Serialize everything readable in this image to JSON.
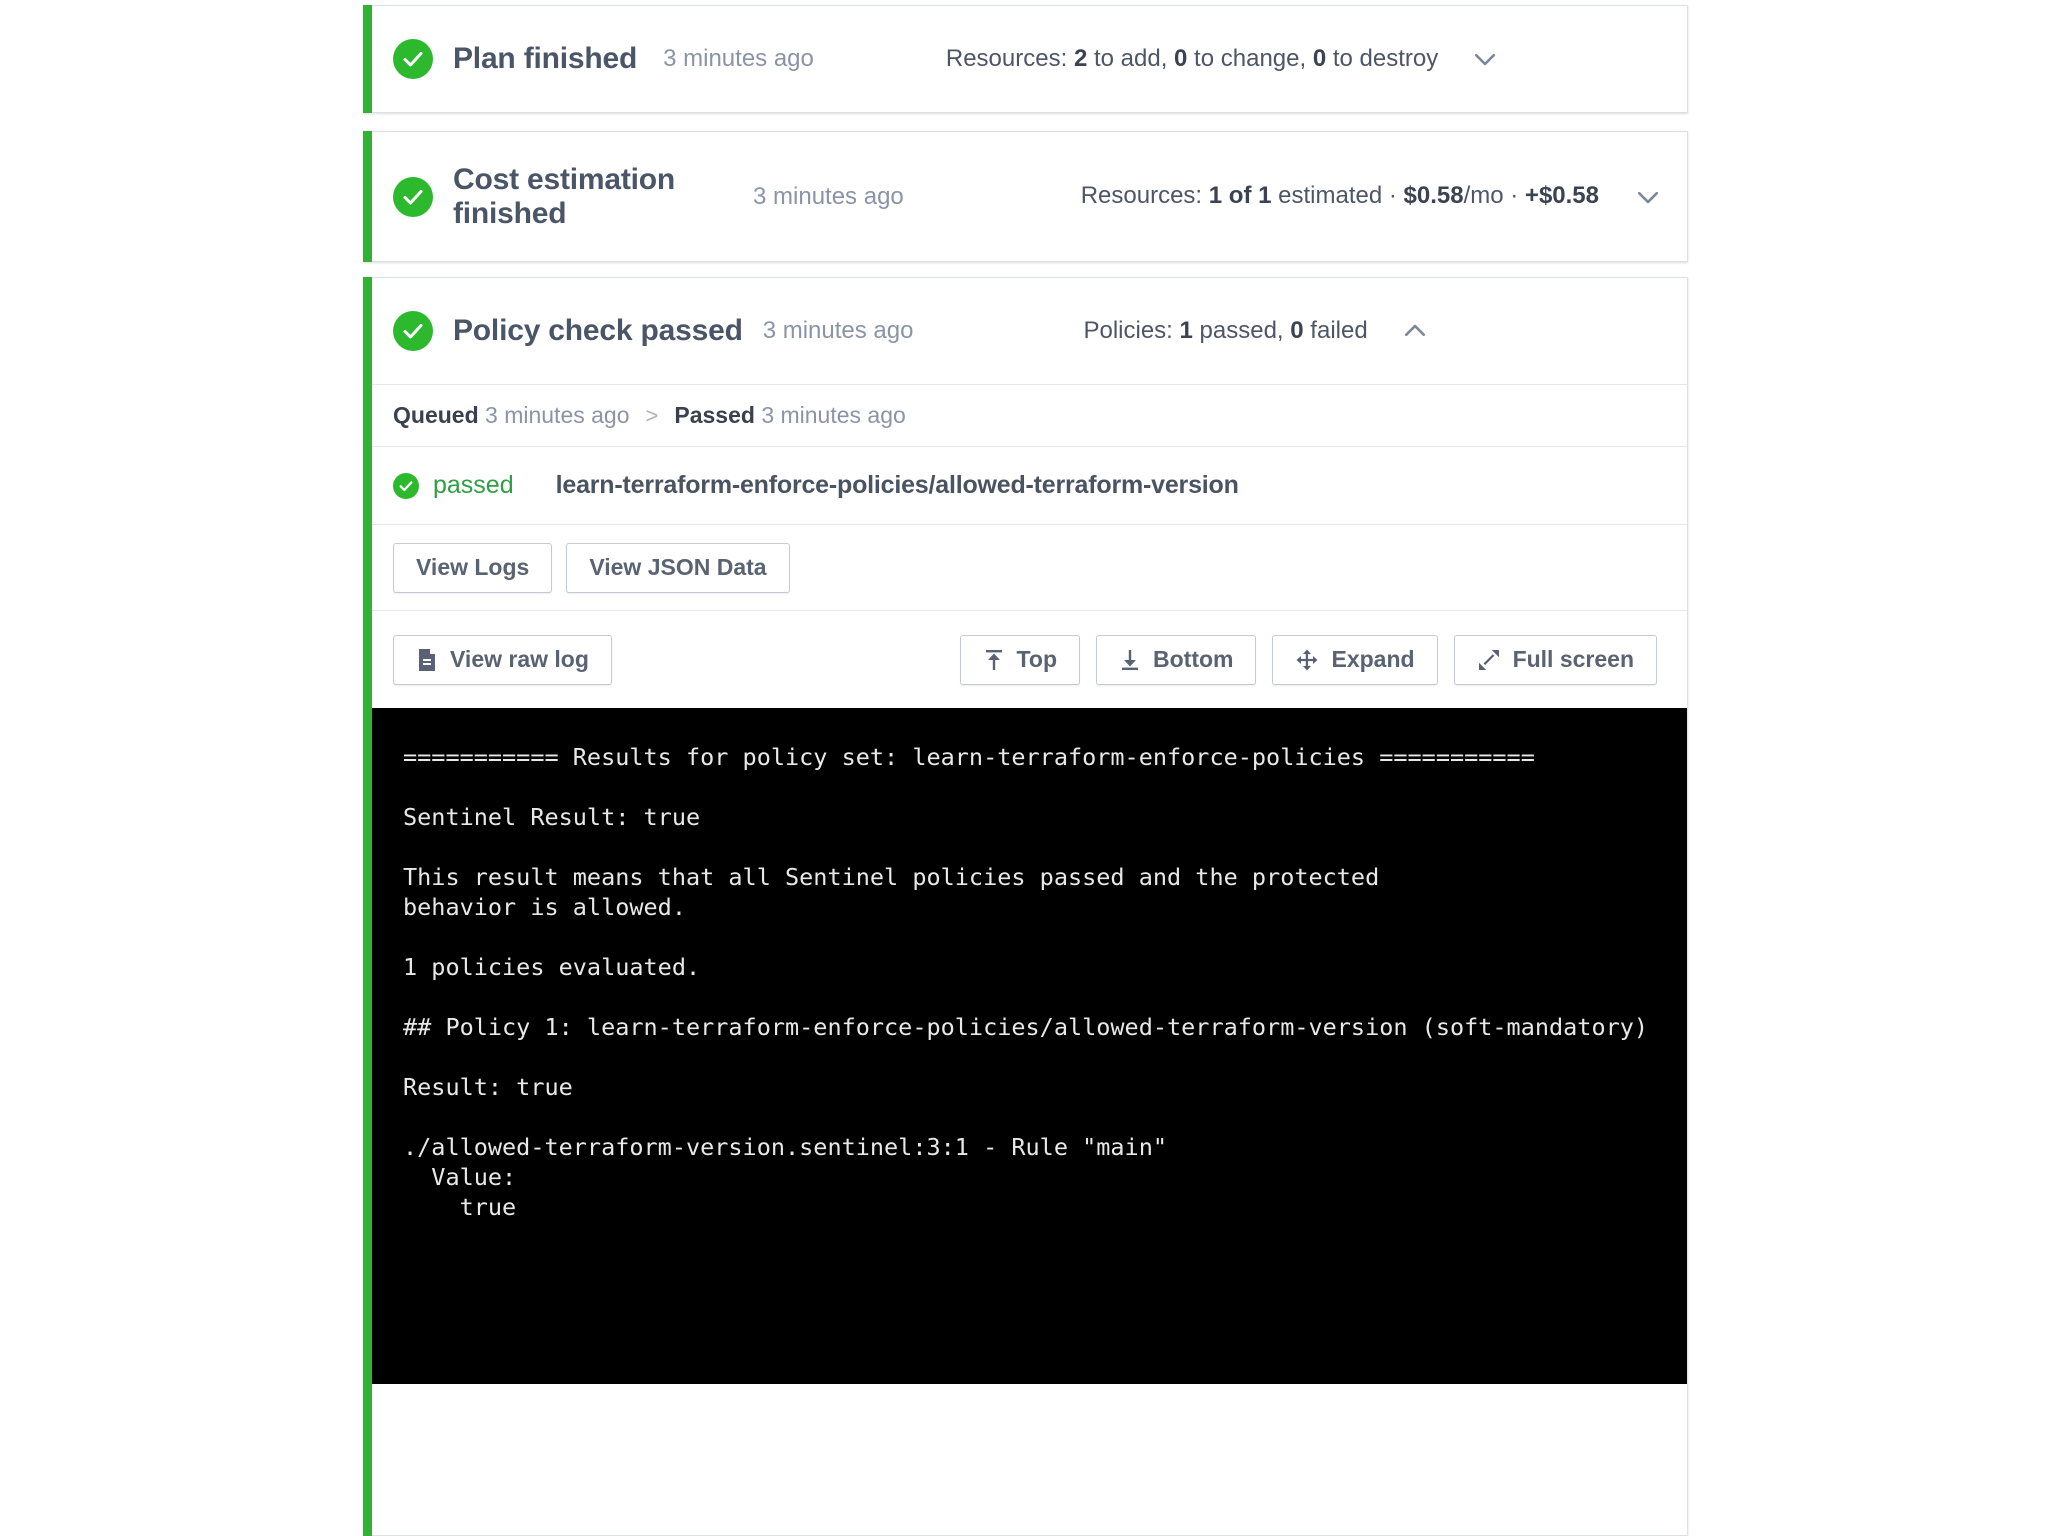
{
  "accent_color": "#32b232",
  "cards": {
    "plan": {
      "title": "Plan finished",
      "time": "3 minutes ago",
      "meta_prefix": "Resources: ",
      "meta_add": "2",
      "meta_add_label": " to add, ",
      "meta_change": "0",
      "meta_change_label": " to change, ",
      "meta_destroy": "0",
      "meta_destroy_label": " to destroy",
      "chevron": "chevron-down"
    },
    "cost": {
      "title": "Cost estimation finished",
      "time": "3 minutes ago",
      "meta_prefix": "Resources: ",
      "meta_count": "1 of 1",
      "meta_estimated": " estimated · ",
      "meta_monthly": "$0.58",
      "meta_per": "/mo · ",
      "meta_delta": "+$0.58",
      "chevron": "chevron-down"
    },
    "policy": {
      "title": "Policy check passed",
      "time": "3 minutes ago",
      "meta_prefix": "Policies: ",
      "meta_passed": "1",
      "meta_passed_label": " passed, ",
      "meta_failed": "0",
      "meta_failed_label": " failed",
      "chevron": "chevron-up",
      "status": {
        "queued_label": "Queued",
        "queued_time": "3 minutes ago",
        "separator": ">",
        "passed_label": "Passed",
        "passed_time": "3 minutes ago"
      },
      "result": {
        "status": "passed",
        "name": "learn-terraform-enforce-policies/allowed-terraform-version"
      },
      "actions": {
        "view_logs": "View Logs",
        "view_json": "View JSON Data"
      },
      "toolbar": {
        "view_raw_log": "View raw log",
        "top": "Top",
        "bottom": "Bottom",
        "expand": "Expand",
        "full_screen": "Full screen"
      },
      "log": "=========== Results for policy set: learn-terraform-enforce-policies ===========\n\nSentinel Result: true\n\nThis result means that all Sentinel policies passed and the protected\nbehavior is allowed.\n\n1 policies evaluated.\n\n## Policy 1: learn-terraform-enforce-policies/allowed-terraform-version (soft-mandatory)\n\nResult: true\n\n./allowed-terraform-version.sentinel:3:1 - Rule \"main\"\n  Value:\n    true"
    }
  }
}
